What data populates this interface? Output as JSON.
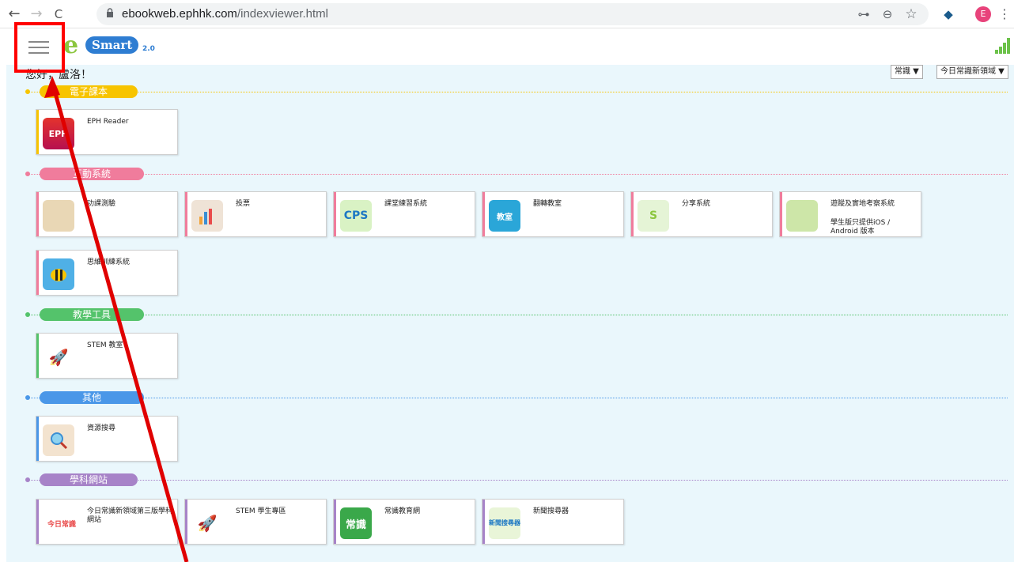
{
  "browser": {
    "url_host": "ebookweb.ephhk.com",
    "url_path": "/indexviewer.html",
    "avatar_letter": "E",
    "back_glyph": "←",
    "forward_glyph": "→",
    "reload_glyph": "C",
    "key_glyph": "⊶",
    "zoom_glyph": "⊖",
    "star_glyph": "☆",
    "ext_glyph": "◆",
    "menu_glyph": "⋮"
  },
  "app": {
    "logo_e": "e",
    "logo_text": "Smart",
    "logo_version": "2.0",
    "greeting": "您好，盧洛！",
    "dropdown_subject": "常識 ▼",
    "dropdown_domain": "今日常識新領域 ▼"
  },
  "sections": [
    {
      "title": "電子課本",
      "color": "#f7c400"
    },
    {
      "title": "互動系統",
      "color": "#f07c9c"
    },
    {
      "title": "教學工具",
      "color": "#54c36b"
    },
    {
      "title": "其他",
      "color": "#4a97e8"
    },
    {
      "title": "學科網站",
      "color": "#a783c8"
    }
  ],
  "cards": {
    "ebook": [
      {
        "label": "EPH Reader",
        "icon": "eph-reader-icon"
      }
    ],
    "interactive": [
      {
        "label": "功課測驗",
        "icon": "homework-icon"
      },
      {
        "label": "投票",
        "icon": "poll-icon"
      },
      {
        "label": "課堂練習系統",
        "icon": "cps-icon",
        "icon_text": "CPS"
      },
      {
        "label": "翻轉教室",
        "icon": "flipped-classroom-icon",
        "icon_text": "教室"
      },
      {
        "label": "分享系統",
        "icon": "share-system-icon"
      },
      {
        "label": "遊蹤及實地考察系統",
        "icon": "field-trip-icon",
        "sub": "學生版只提供iOS / Android 版本"
      },
      {
        "label": "思維訓練系統",
        "icon": "thinking-bee-icon"
      }
    ],
    "tools": [
      {
        "label": "STEM 教室",
        "icon": "stem-rocket-icon"
      }
    ],
    "others": [
      {
        "label": "資源搜尋",
        "icon": "resource-search-icon"
      }
    ],
    "websites": [
      {
        "label": "今日常識新領域第三版學科網站",
        "icon": "today-gs-logo-icon"
      },
      {
        "label": "STEM 學生專區",
        "icon": "stem-student-icon"
      },
      {
        "label": "常識教育網",
        "icon": "gs-edu-net-icon",
        "icon_text": "常識"
      },
      {
        "label": "新聞搜尋器",
        "icon": "news-search-icon",
        "icon_text": "新聞搜尋器"
      }
    ]
  }
}
